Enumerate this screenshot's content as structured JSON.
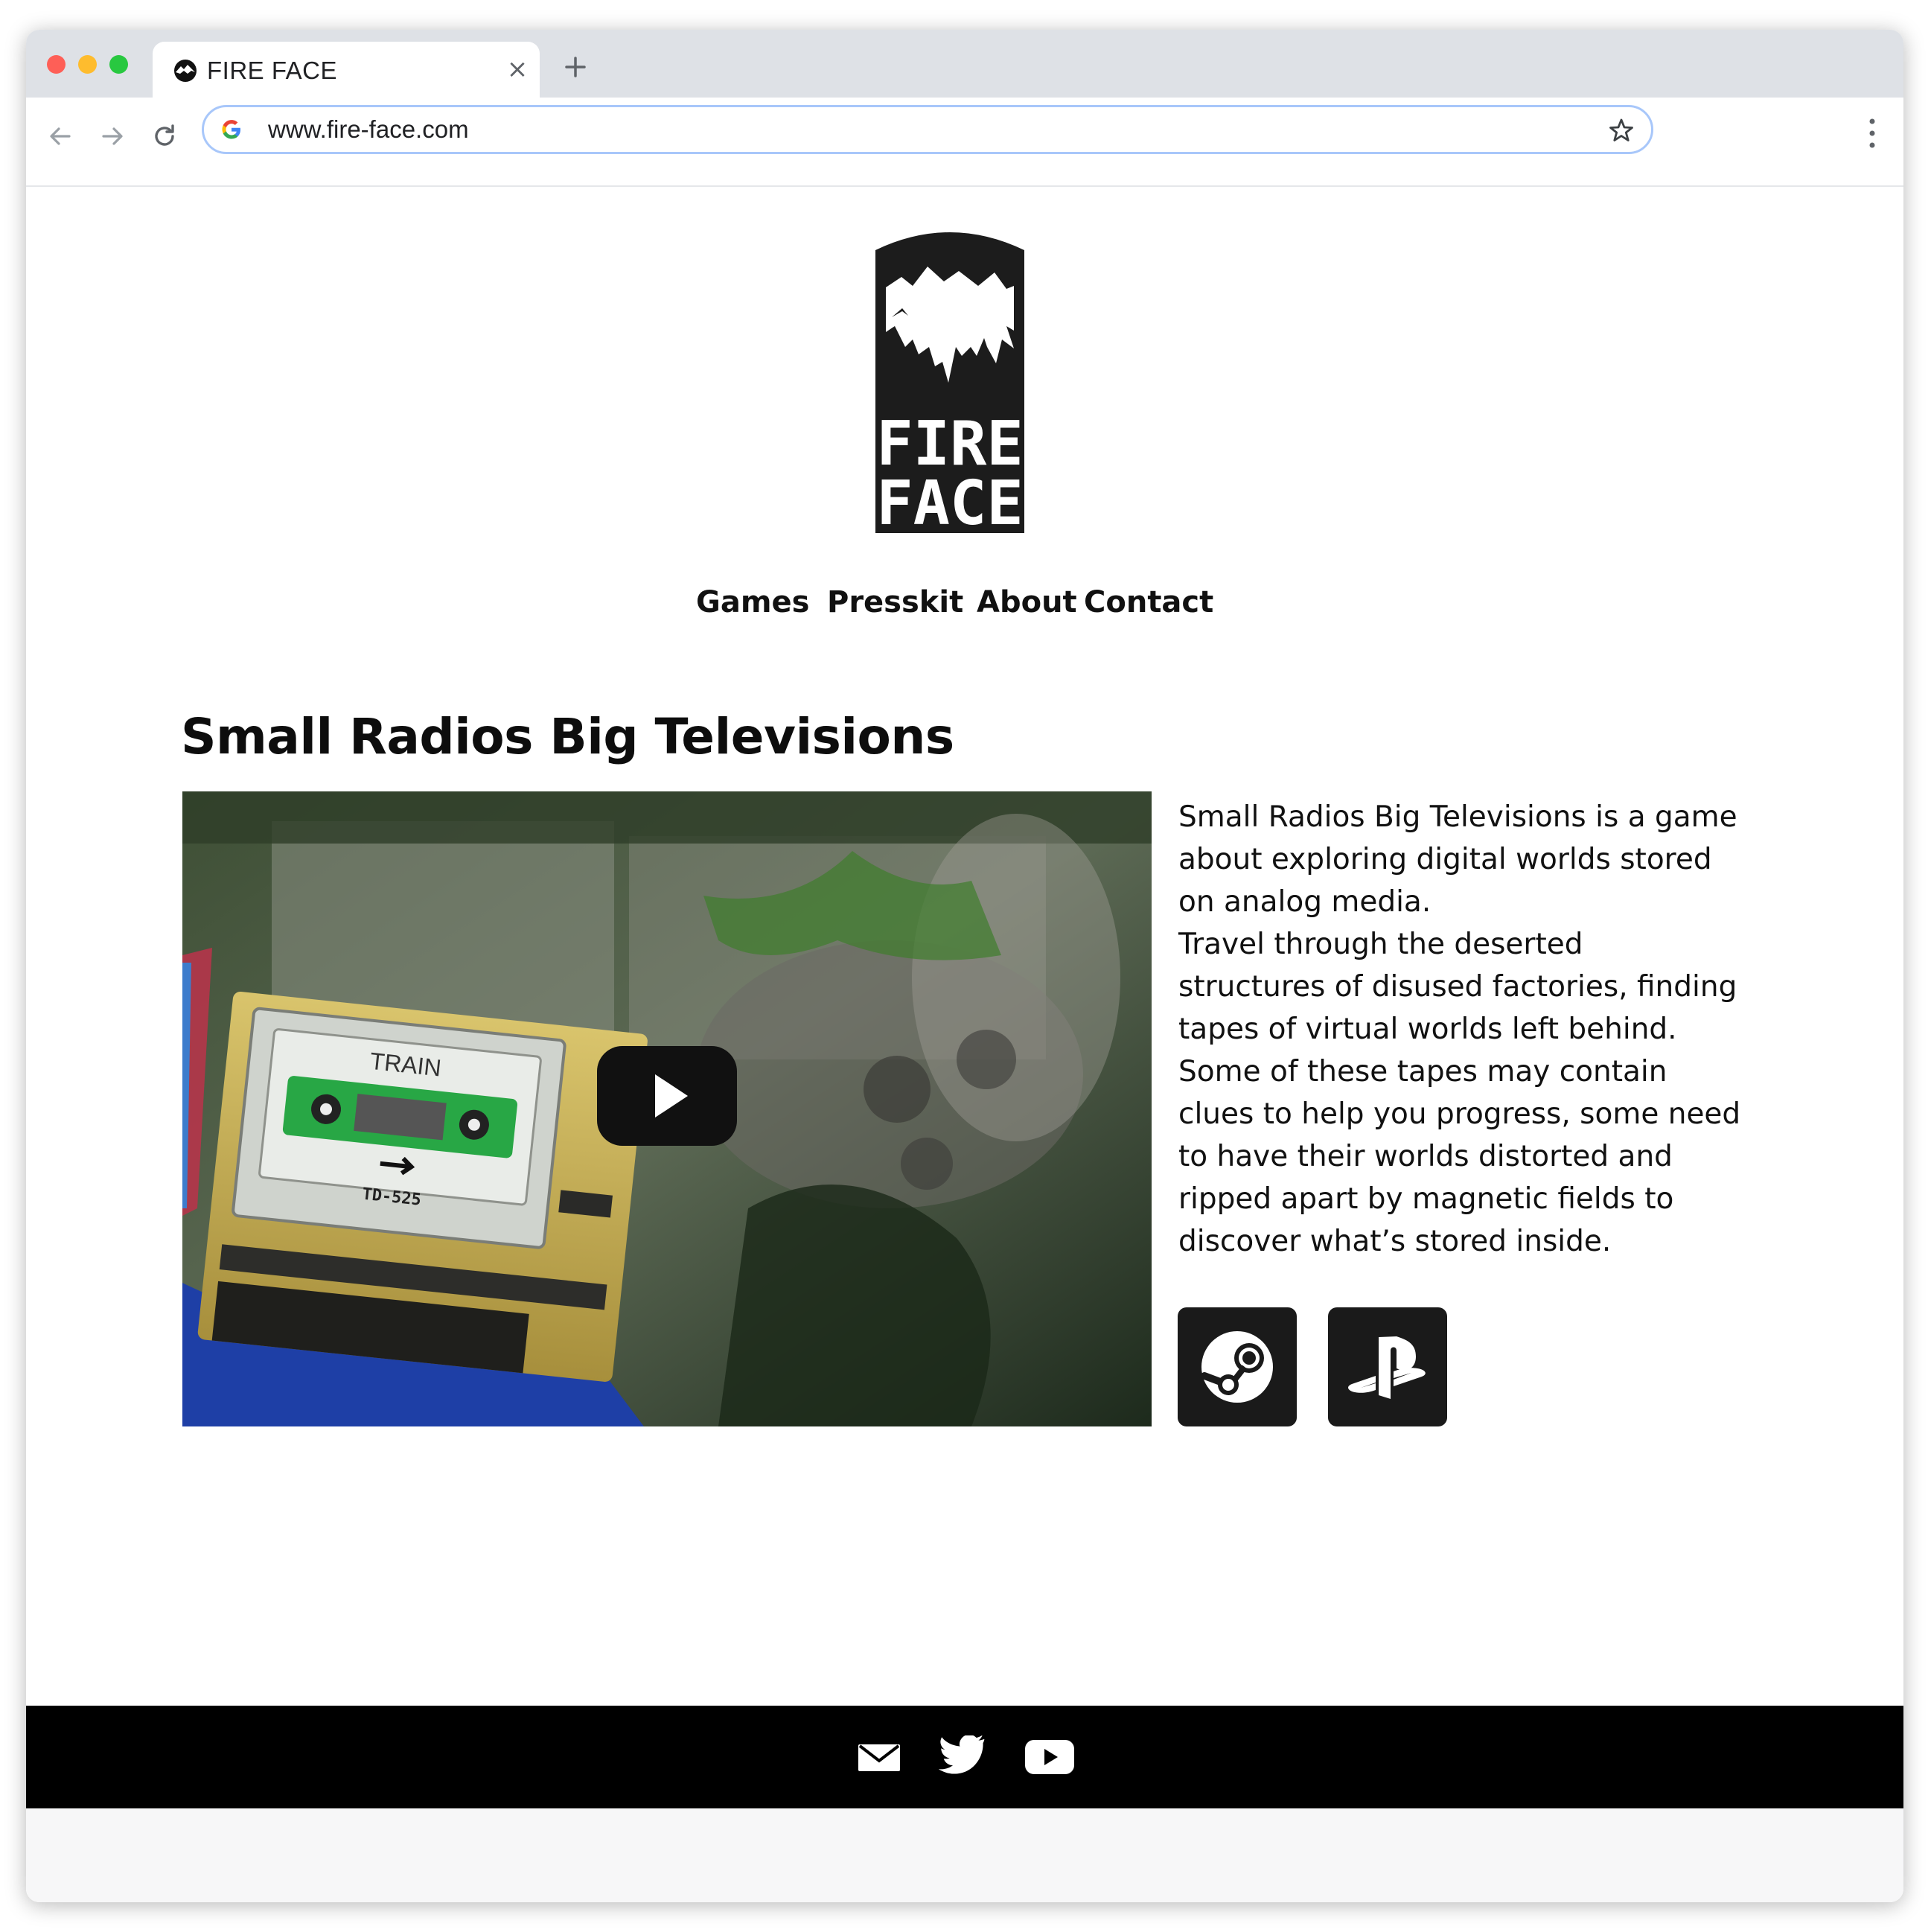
{
  "browser": {
    "tab_title": "FIRE FACE",
    "url": "www.fire-face.com"
  },
  "site": {
    "logo_text_line1": "FIRE",
    "logo_text_line2": "FACE",
    "nav": [
      "Games",
      "Presskit",
      "About",
      "Contact"
    ]
  },
  "game": {
    "title": "Small Radios Big Televisions",
    "description": [
      "Small Radios Big Televisions is a game",
      "about exploring digital worlds stored",
      "on analog media.",
      "Travel through the deserted",
      "structures of disused factories, finding",
      "tapes of virtual worlds left behind.",
      "Some of these tapes may contain",
      "clues to help you progress, some need",
      "to have their worlds distorted and",
      "ripped apart by magnetic fields to",
      "discover what’s stored inside."
    ],
    "video_thumbnail": {
      "cassette_label": "TRAIN",
      "deck_model": "TD-525"
    },
    "stores": [
      "steam-icon",
      "playstation-icon"
    ]
  },
  "footer": {
    "icons": [
      "mail-icon",
      "twitter-icon",
      "youtube-icon"
    ]
  },
  "colors": {
    "tabbar": "#dee1e6",
    "omnibox_border": "#a8c7fa",
    "footer": "#000000",
    "store_button": "#1a1a1a"
  }
}
